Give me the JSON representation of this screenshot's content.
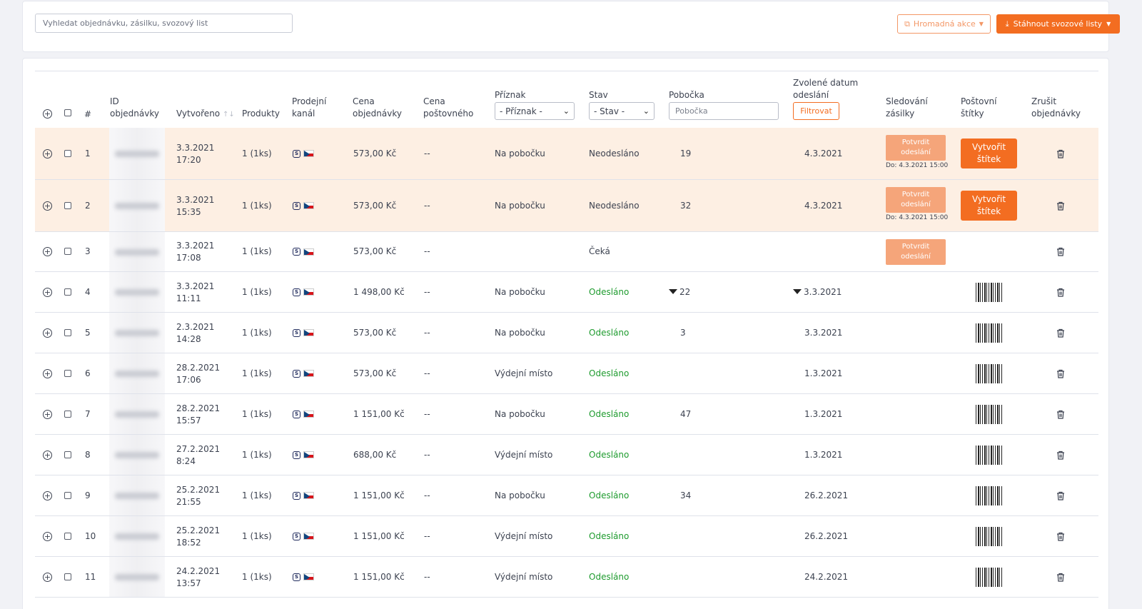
{
  "toolbar": {
    "search_placeholder": "Vyhledat objednávku, zásilku, svozový list",
    "bulk_action_label": "Hromadná akce",
    "download_label": "Stáhnout svozové listy"
  },
  "table": {
    "headers": {
      "number": "#",
      "order_id_1": "ID",
      "order_id_2": "objednávky",
      "created": "Vytvořeno",
      "created_sort": "↑↓",
      "products": "Produkty",
      "channel_1": "Prodejní",
      "channel_2": "kanál",
      "price_1": "Cena",
      "price_2": "objednávky",
      "postage_1": "Cena",
      "postage_2": "poštovného",
      "flag": "Příznak",
      "state": "Stav",
      "branch": "Pobočka",
      "date_1": "Zvolené datum",
      "date_2": "odeslání",
      "tracking_1": "Sledování",
      "tracking_2": "zásilky",
      "labels_1": "Poštovní",
      "labels_2": "štítky",
      "cancel_1": "Zrušit",
      "cancel_2": "objednávky"
    },
    "filters": {
      "flag_select": "- Příznak -",
      "state_select": "- Stav -",
      "branch_placeholder": "Pobočka",
      "filter_button": "Filtrovat"
    },
    "confirm_label_1": "Potvrdit",
    "confirm_label_2": "odeslání",
    "create_label_1": "Vytvořit",
    "create_label_2": "štítek",
    "rows": [
      {
        "num": "1",
        "date": "3.3.2021",
        "time": "17:20",
        "products": "1 (1ks)",
        "price": "573,00 Kč",
        "postage": "--",
        "flag": "Na pobočku",
        "state": "Neodesláno",
        "branch": "19",
        "send_date": "4.3.2021",
        "due": "Do: 4.3.2021 15:00"
      },
      {
        "num": "2",
        "date": "3.3.2021",
        "time": "15:35",
        "products": "1 (1ks)",
        "price": "573,00 Kč",
        "postage": "--",
        "flag": "Na pobočku",
        "state": "Neodesláno",
        "branch": "32",
        "send_date": "4.3.2021",
        "due": "Do: 4.3.2021 15:00"
      },
      {
        "num": "3",
        "date": "3.3.2021",
        "time": "17:08",
        "products": "1 (1ks)",
        "price": "573,00 Kč",
        "postage": "--",
        "flag": "",
        "state": "Čeká",
        "branch": "",
        "send_date": ""
      },
      {
        "num": "4",
        "date": "3.3.2021",
        "time": "11:11",
        "products": "1 (1ks)",
        "price": "1 498,00 Kč",
        "postage": "--",
        "flag": "Na pobočku",
        "state": "Odesláno",
        "branch": "22",
        "send_date": "3.3.2021"
      },
      {
        "num": "5",
        "date": "2.3.2021",
        "time": "14:28",
        "products": "1 (1ks)",
        "price": "573,00 Kč",
        "postage": "--",
        "flag": "Na pobočku",
        "state": "Odesláno",
        "branch": "3",
        "send_date": "3.3.2021"
      },
      {
        "num": "6",
        "date": "28.2.2021",
        "time": "17:06",
        "products": "1 (1ks)",
        "price": "573,00 Kč",
        "postage": "--",
        "flag": "Výdejní místo",
        "state": "Odesláno",
        "branch": "",
        "send_date": "1.3.2021"
      },
      {
        "num": "7",
        "date": "28.2.2021",
        "time": "15:57",
        "products": "1 (1ks)",
        "price": "1 151,00 Kč",
        "postage": "--",
        "flag": "Na pobočku",
        "state": "Odesláno",
        "branch": "47",
        "send_date": "1.3.2021"
      },
      {
        "num": "8",
        "date": "27.2.2021",
        "time": "8:24",
        "products": "1 (1ks)",
        "price": "688,00 Kč",
        "postage": "--",
        "flag": "Výdejní místo",
        "state": "Odesláno",
        "branch": "",
        "send_date": "1.3.2021"
      },
      {
        "num": "9",
        "date": "25.2.2021",
        "time": "21:55",
        "products": "1 (1ks)",
        "price": "1 151,00 Kč",
        "postage": "--",
        "flag": "Na pobočku",
        "state": "Odesláno",
        "branch": "34",
        "send_date": "26.2.2021"
      },
      {
        "num": "10",
        "date": "25.2.2021",
        "time": "18:52",
        "products": "1 (1ks)",
        "price": "1 151,00 Kč",
        "postage": "--",
        "flag": "Výdejní místo",
        "state": "Odesláno",
        "branch": "",
        "send_date": "26.2.2021"
      },
      {
        "num": "11",
        "date": "24.2.2021",
        "time": "13:57",
        "products": "1 (1ks)",
        "price": "1 151,00 Kč",
        "postage": "--",
        "flag": "Výdejní místo",
        "state": "Odesláno",
        "branch": "",
        "send_date": "24.2.2021"
      }
    ]
  },
  "colors": {
    "accent": "#f36d21",
    "accent_light": "#f5a57a",
    "highlight_row": "#fdefe3",
    "sent_green": "#1e9b2e"
  },
  "icons": {
    "expand": "plus-circle-icon",
    "cancel": "trash-icon",
    "label": "barcode-icon",
    "filter": "funnel-icon",
    "channel": "shop-channel-icon",
    "country": "czech-flag-icon"
  }
}
